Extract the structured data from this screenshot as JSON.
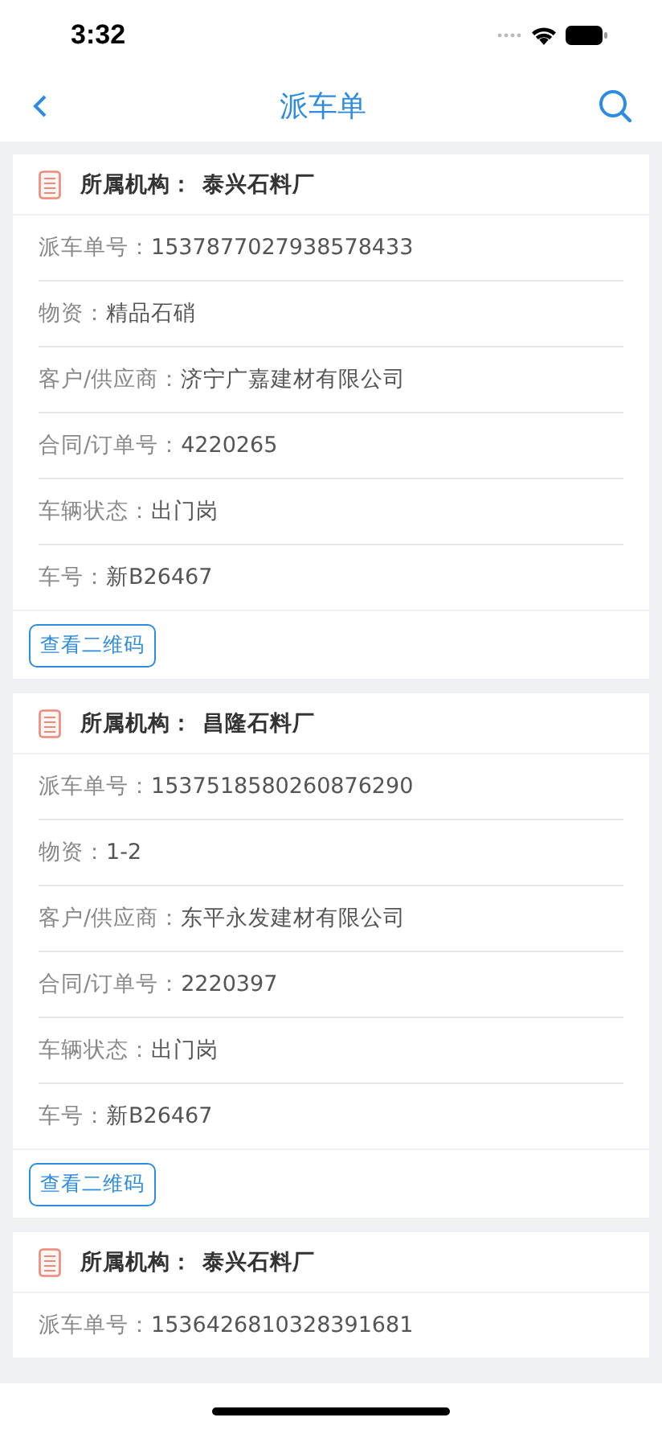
{
  "status_bar": {
    "time": "3:32"
  },
  "nav": {
    "title": "派车单"
  },
  "orders": [
    {
      "org_label": "所属机构：",
      "org": "泰兴石料厂",
      "fields": [
        {
          "label": "派车单号：",
          "value": "1537877027938578433"
        },
        {
          "label": "物资：",
          "value": "精品石硝"
        },
        {
          "label": "客户/供应商：",
          "value": "济宁广嘉建材有限公司"
        },
        {
          "label": "合同/订单号：",
          "value": "4220265"
        },
        {
          "label": "车辆状态：",
          "value": "出门岗"
        },
        {
          "label": "车号：",
          "value": "新B26467"
        }
      ],
      "button": "查看二维码"
    },
    {
      "org_label": "所属机构：",
      "org": "昌隆石料厂",
      "fields": [
        {
          "label": "派车单号：",
          "value": "1537518580260876290"
        },
        {
          "label": "物资：",
          "value": "1-2"
        },
        {
          "label": "客户/供应商：",
          "value": "东平永发建材有限公司"
        },
        {
          "label": "合同/订单号：",
          "value": "2220397"
        },
        {
          "label": "车辆状态：",
          "value": "出门岗"
        },
        {
          "label": "车号：",
          "value": "新B26467"
        }
      ],
      "button": "查看二维码"
    },
    {
      "org_label": "所属机构：",
      "org": "泰兴石料厂",
      "fields": [
        {
          "label": "派车单号：",
          "value": "1536426810328391681"
        }
      ]
    }
  ]
}
